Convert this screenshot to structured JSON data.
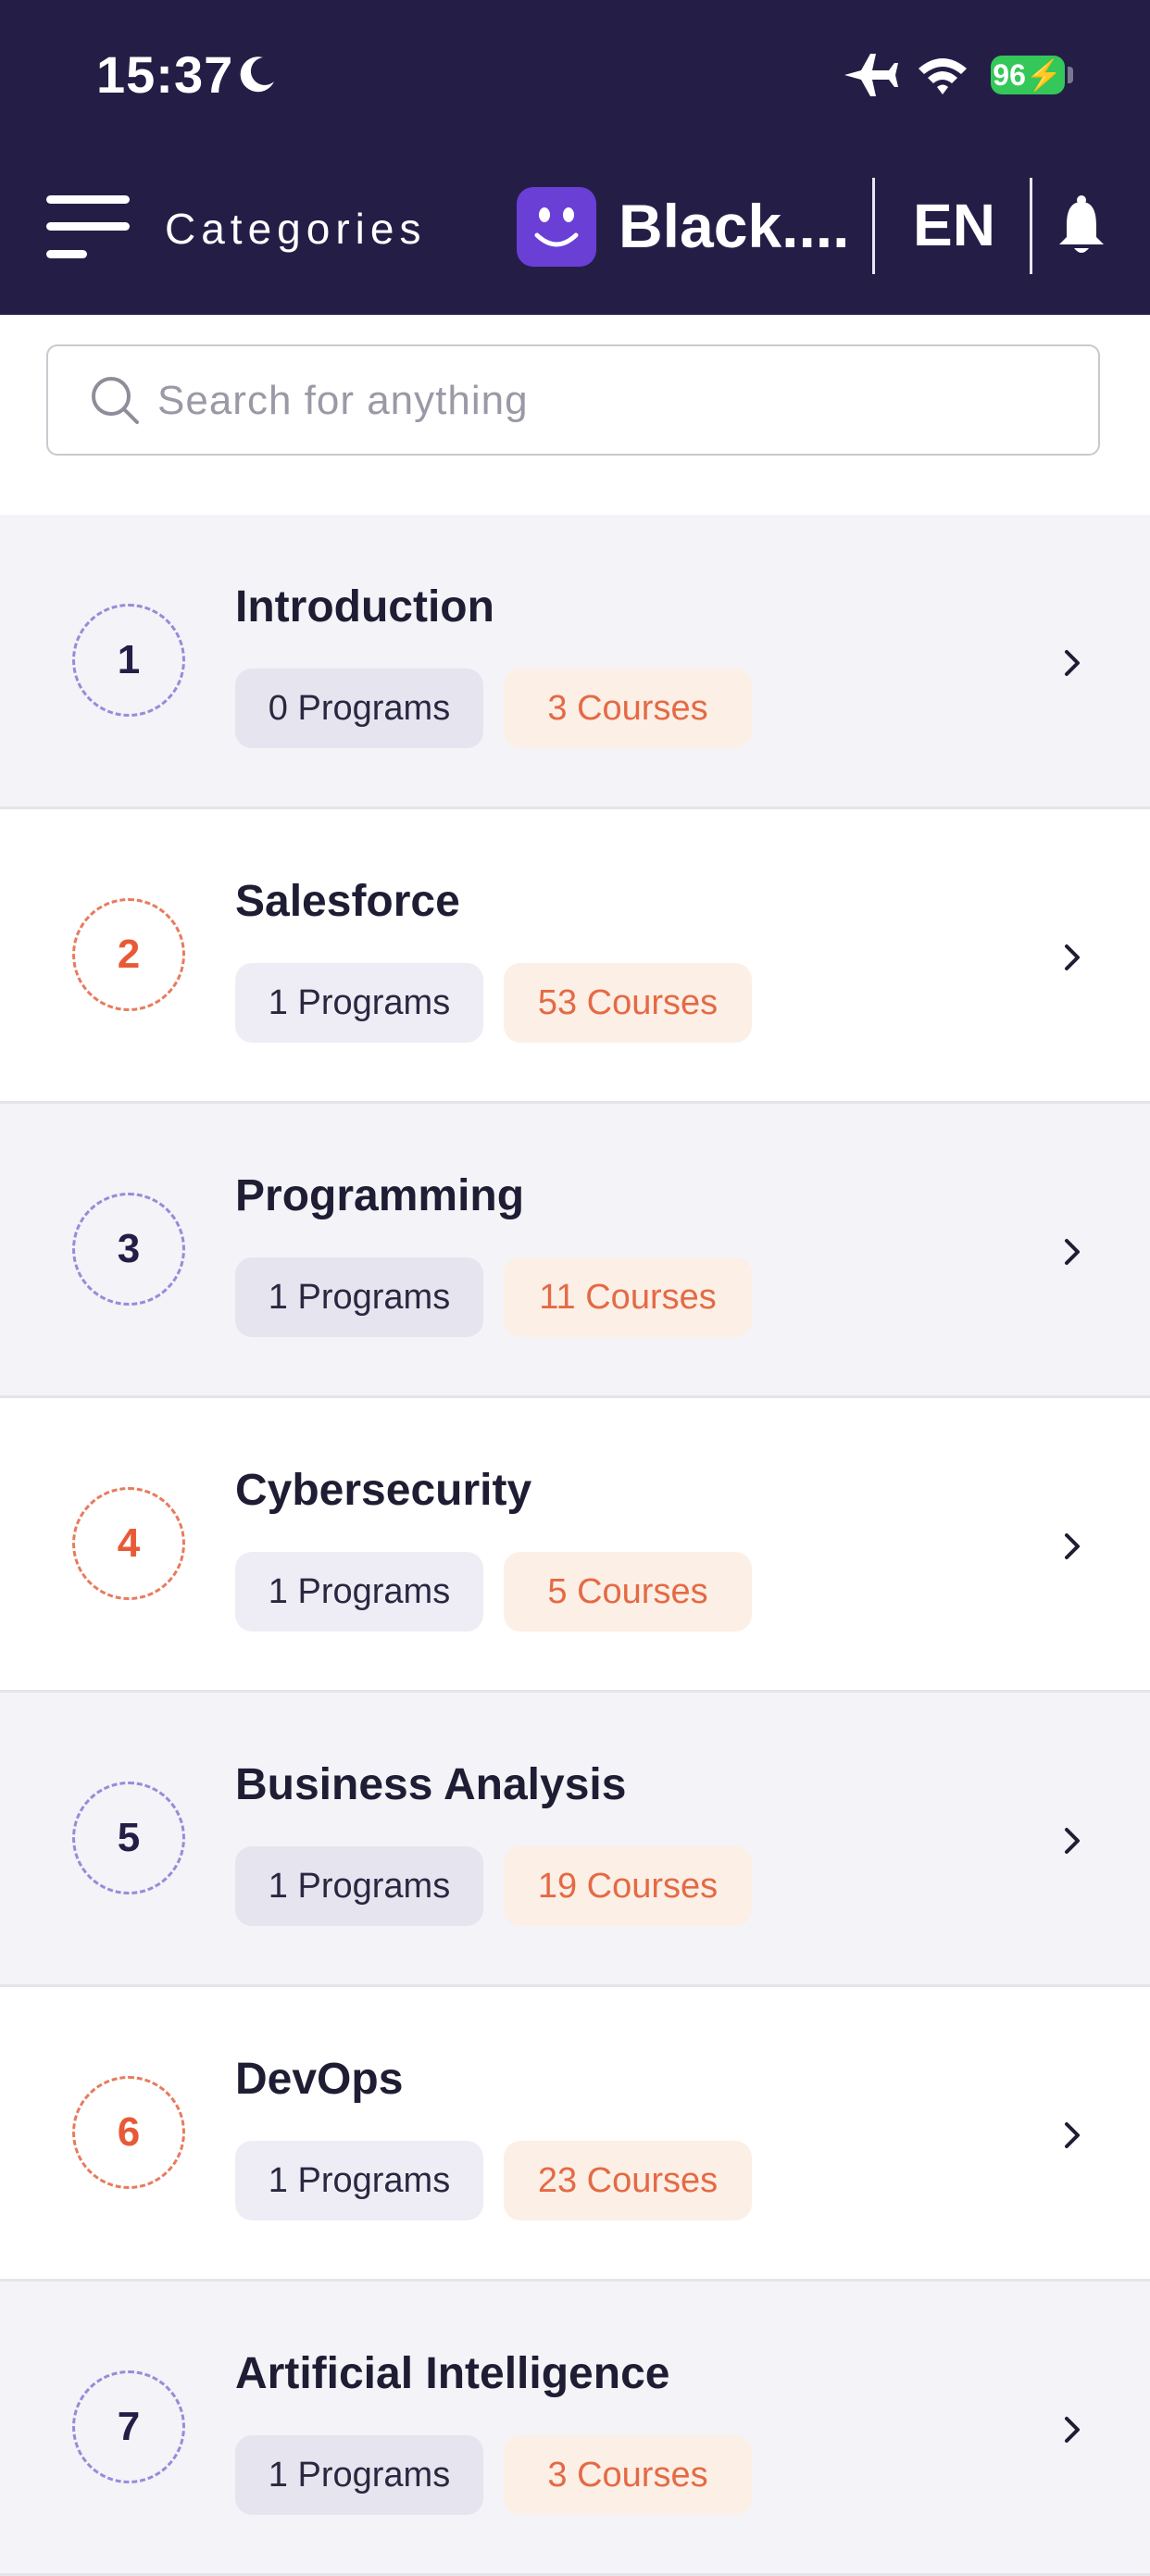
{
  "status_bar": {
    "time": "15:37",
    "battery": "96"
  },
  "header": {
    "menu_label": "Categories",
    "brand": "Black....",
    "language": "EN"
  },
  "search": {
    "placeholder": "Search for anything",
    "value": ""
  },
  "categories": [
    {
      "index": "1",
      "title": "Introduction",
      "programs": "0 Programs",
      "courses": "3 Courses"
    },
    {
      "index": "2",
      "title": "Salesforce",
      "programs": "1 Programs",
      "courses": "53 Courses"
    },
    {
      "index": "3",
      "title": "Programming",
      "programs": "1 Programs",
      "courses": "11 Courses"
    },
    {
      "index": "4",
      "title": "Cybersecurity",
      "programs": "1 Programs",
      "courses": "5 Courses"
    },
    {
      "index": "5",
      "title": "Business Analysis",
      "programs": "1 Programs",
      "courses": "19 Courses"
    },
    {
      "index": "6",
      "title": "DevOps",
      "programs": "1 Programs",
      "courses": "23 Courses"
    },
    {
      "index": "7",
      "title": "Artificial Intelligence",
      "programs": "1 Programs",
      "courses": "3 Courses"
    }
  ],
  "colors": {
    "header_bg": "#241e47",
    "accent_orange": "#e85a36",
    "accent_purple": "#6a3fd6"
  },
  "icons": [
    "moon-icon",
    "airplane-icon",
    "wifi-icon",
    "battery-icon",
    "hamburger-menu-icon",
    "smiley-logo-icon",
    "bell-icon",
    "search-icon",
    "chevron-right-icon"
  ]
}
